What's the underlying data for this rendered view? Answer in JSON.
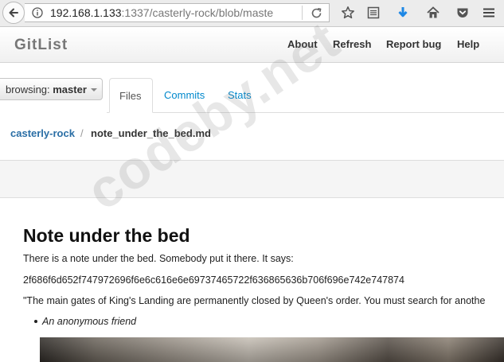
{
  "browser": {
    "url_host": "192.168.1.133",
    "url_rest": ":1337/casterly-rock/blob/maste"
  },
  "navbar": {
    "brand": "GitList",
    "links": [
      "About",
      "Refresh",
      "Report bug",
      "Help"
    ]
  },
  "branch": {
    "prefix": "browsing: ",
    "name": "master"
  },
  "tabs": [
    {
      "label": "Files",
      "active": true
    },
    {
      "label": "Commits",
      "active": false
    },
    {
      "label": "Stats",
      "active": false
    }
  ],
  "breadcrumb": {
    "repo": "casterly-rock",
    "separator": "/",
    "file": "note_under_the_bed.md"
  },
  "document": {
    "title": "Note under the bed",
    "intro": "There is a note under the bed. Somebody put it there. It says:",
    "hex": "2f686f6d652f747972696f6e6c616e6e69737465722f636865636b706f696e742e747874",
    "quote": "\"The main gates of King's Landing are permanently closed by Queen's order. You must search for anothe",
    "signature": "An anonymous friend"
  },
  "watermark": "codeby.net",
  "colors": {
    "link": "#0088cc",
    "download_arrow": "#1e88e5"
  }
}
